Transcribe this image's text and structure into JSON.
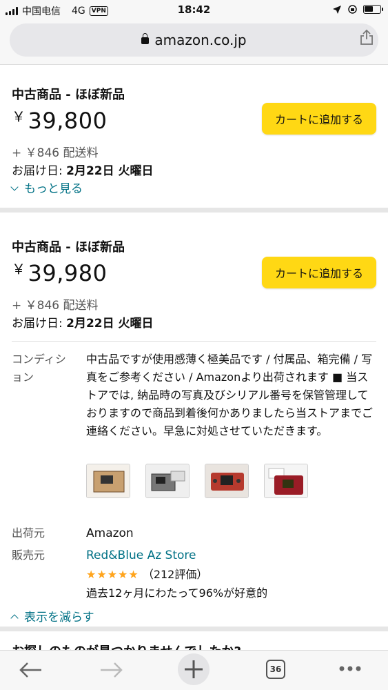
{
  "status_bar": {
    "carrier": "中国电信",
    "network": "4G",
    "vpn": "VPN",
    "time": "18:42"
  },
  "browser": {
    "url": "amazon.co.jp",
    "tab_count": "36"
  },
  "offers": [
    {
      "condition": "中古商品 - ほぼ新品",
      "yen": "￥",
      "price": "39,800",
      "shipping": "+ ￥846 配送料",
      "delivery_prefix": "お届け日: ",
      "delivery_date": "2月22日 火曜日",
      "cart_label": "カートに追加する",
      "more_label": "もっと見る"
    },
    {
      "condition": "中古商品 - ほぼ新品",
      "yen": "￥",
      "price": "39,980",
      "shipping": "+ ￥846 配送料",
      "delivery_prefix": "お届け日: ",
      "delivery_date": "2月22日 火曜日",
      "cart_label": "カートに追加する",
      "details": {
        "condition_label": "コンディション",
        "condition_text": "中古品ですが使用感薄く極美品です / 付属品、箱完備 / 写真をご参考ください / Amazonより出荷されます ■ 当ストアでは, 納品時の写真及びシリアル番号を保管管理しておりますので商品到着後何かありましたら当ストアまでご連絡ください。早急に対処させていただきます。",
        "ships_from_label": "出荷元",
        "ships_from": "Amazon",
        "sold_by_label": "販売元",
        "seller": "Red&Blue Az Store",
        "stars": "★★★★★",
        "rating_count": "（212評価）",
        "feedback": "過去12ヶ月にわたって96%が好意的",
        "less_label": "表示を減らす"
      }
    }
  ],
  "teaser": "お探しのものが見つかりませんでしたか?",
  "colors": {
    "cart_button": "#ffd814",
    "link": "#007185",
    "stars": "#ffa41c"
  }
}
